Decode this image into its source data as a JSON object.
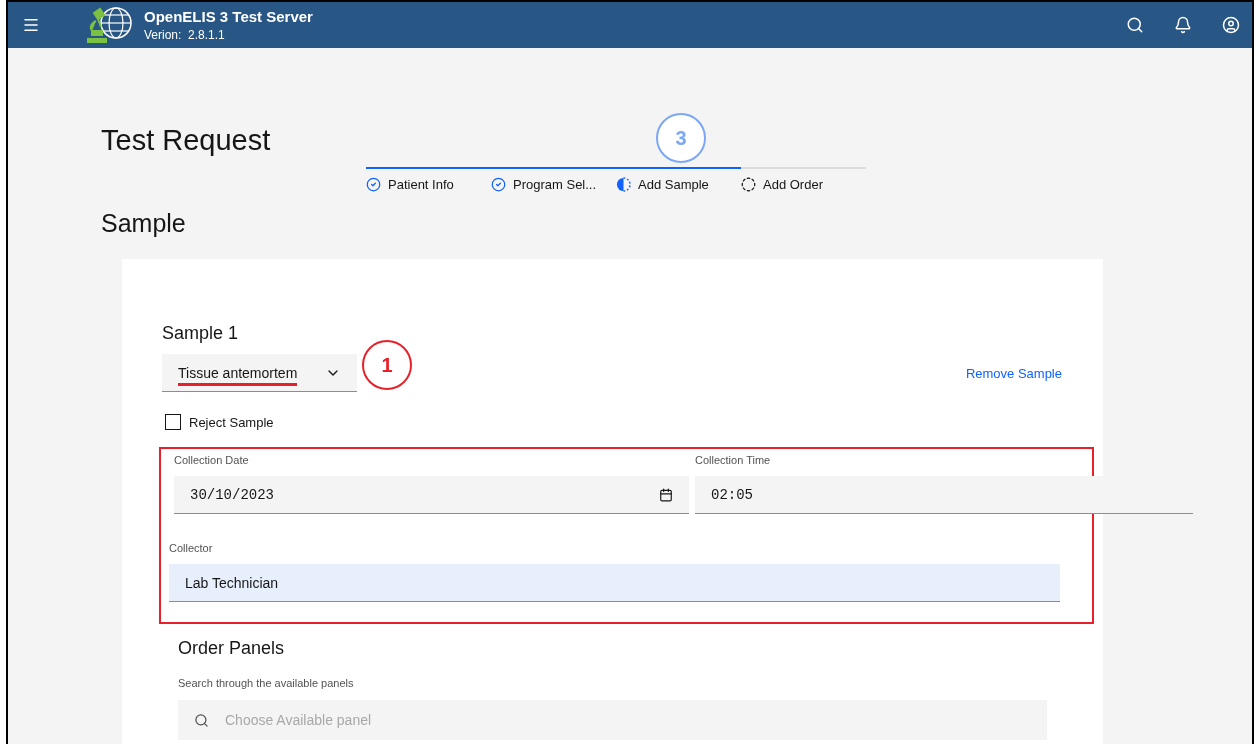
{
  "header": {
    "title": "OpenELIS 3 Test Server",
    "version_label": "Verion:",
    "version": "2.8.1.1"
  },
  "page_title": "Test Request",
  "stepper": {
    "marker": "3",
    "level": 0.75,
    "steps": [
      {
        "label": "Patient Info",
        "kind": "complete"
      },
      {
        "label": "Program Sel...",
        "kind": "complete"
      },
      {
        "label": "Add Sample",
        "kind": "current"
      },
      {
        "label": "Add Order",
        "kind": "incomplete"
      }
    ]
  },
  "section_title": "Sample",
  "sample": {
    "title": "Sample 1",
    "type_select": {
      "value": "Tissue antemortem",
      "marker": "1"
    },
    "remove_link": "Remove Sample",
    "reject": {
      "label": "Reject Sample",
      "checked": false
    },
    "collection_date": {
      "label": "Collection Date",
      "value": "30/10/2023"
    },
    "collection_time": {
      "label": "Collection Time",
      "value": "02:05"
    },
    "collector": {
      "label": "Collector",
      "value": "Lab Technician"
    }
  },
  "order_panels": {
    "title": "Order Panels",
    "search_label": "Search through the available panels",
    "placeholder": "Choose Available panel"
  }
}
